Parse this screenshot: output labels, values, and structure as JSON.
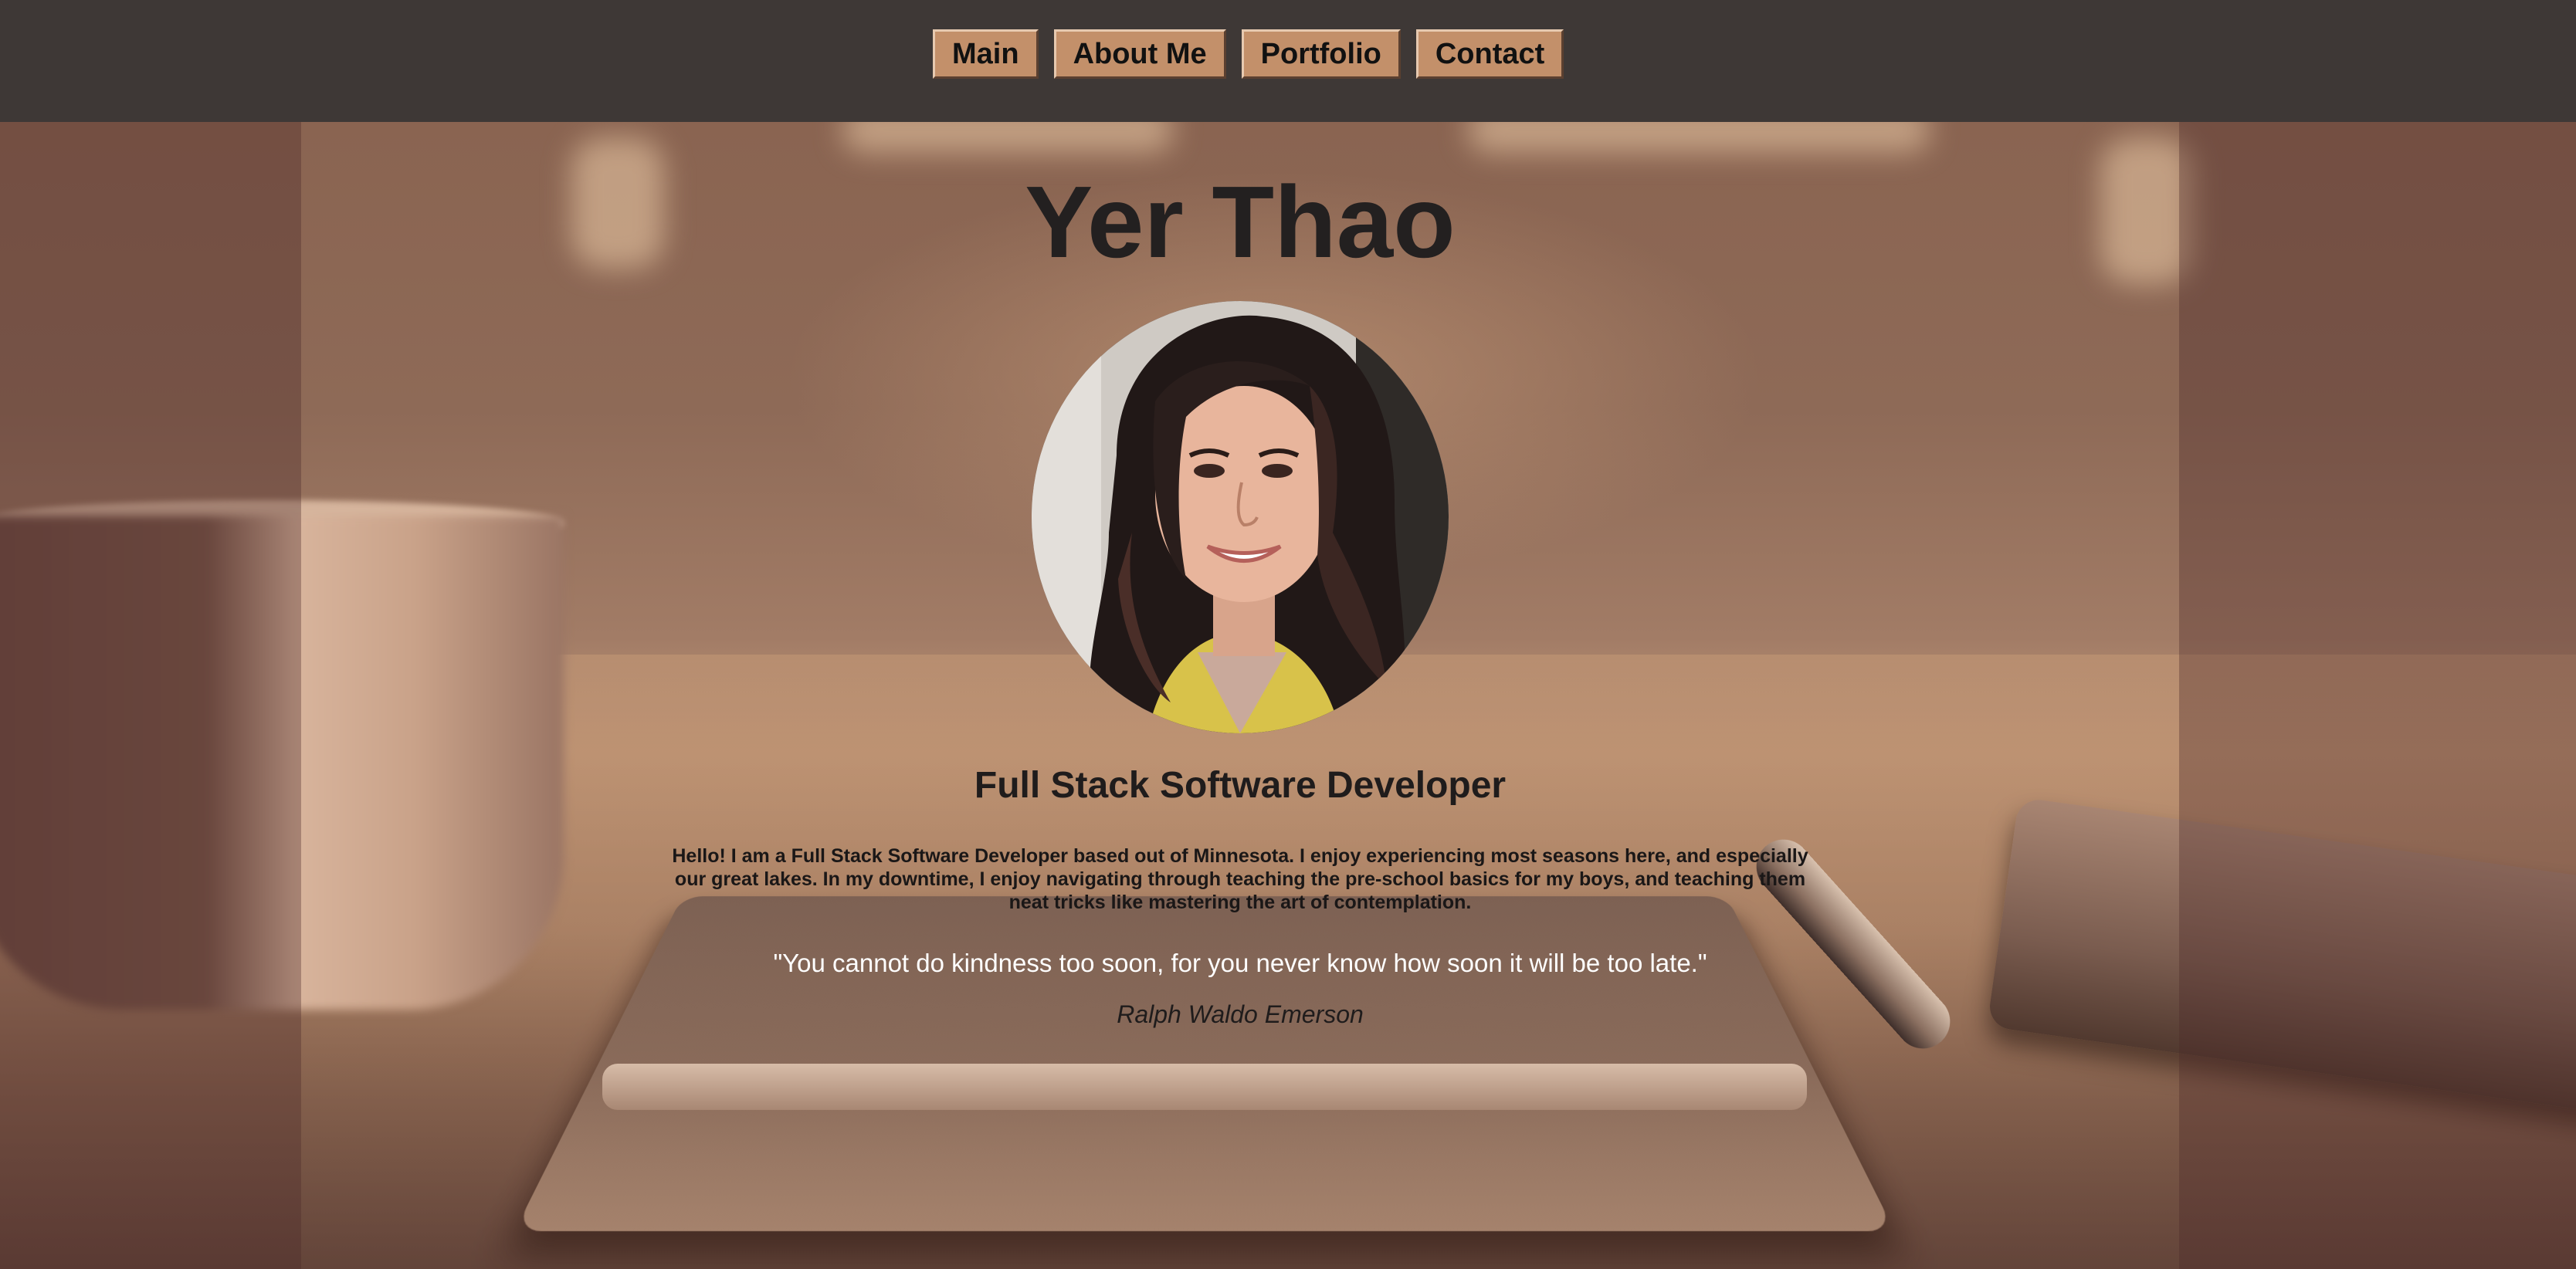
{
  "nav": {
    "items": [
      {
        "label": "Main"
      },
      {
        "label": "About Me"
      },
      {
        "label": "Portfolio"
      },
      {
        "label": "Contact"
      }
    ]
  },
  "profile": {
    "name": "Yer Thao",
    "title": "Full Stack Software Developer",
    "bio": "Hello! I am a Full Stack Software Developer based out of Minnesota. I enjoy experiencing most seasons here, and especially our great lakes. In my downtime, I enjoy navigating through teaching the pre-school basics for my boys, and teaching them neat tricks like mastering the art of contemplation.",
    "quote": "\"You cannot do kindness too soon, for you never know how soon it will be too late.\"",
    "quote_author": "Ralph Waldo Emerson"
  },
  "colors": {
    "nav_background": "#3e3836",
    "nav_button": "#c3906a",
    "heading_text": "#232020",
    "quote_text": "#ffffff"
  }
}
